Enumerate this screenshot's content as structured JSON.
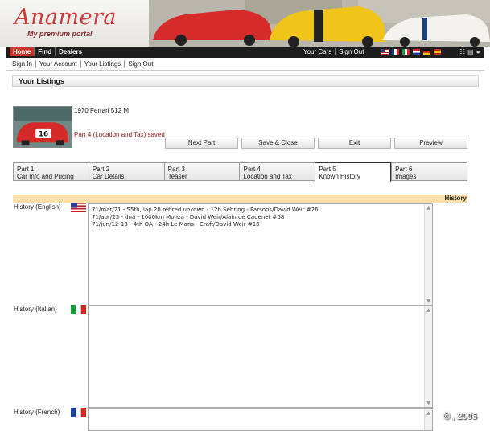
{
  "brand": {
    "logo": "Anamera",
    "tagline": "My premium portal"
  },
  "topnav": {
    "primary": [
      "Home",
      "Find",
      "Dealers"
    ],
    "active": "Home",
    "secondary": [
      "Your Cars",
      "Sign Out"
    ],
    "flags": [
      "us-flag",
      "fr-flag",
      "it-flag",
      "nl-flag",
      "de-flag",
      "es-flag"
    ]
  },
  "subnav": [
    "Sign In",
    "Your Account",
    "Your Listings",
    "Sign Out"
  ],
  "section_title": "Your Listings",
  "listing": {
    "name": "1970 Ferrari 512 M",
    "status": "Part 4 (Location and Tax) saved",
    "thumb_number": "16"
  },
  "buttons": {
    "next": "Next Part",
    "save_close": "Save & Close",
    "exit": "Exit",
    "preview": "Preview"
  },
  "tabs": [
    {
      "part": "Part 1",
      "label": "Car Info and Pricing"
    },
    {
      "part": "Part 2",
      "label": "Car Details"
    },
    {
      "part": "Part 3",
      "label": "Teaser"
    },
    {
      "part": "Part 4",
      "label": "Location and Tax"
    },
    {
      "part": "Part 5",
      "label": "Known History"
    },
    {
      "part": "Part 6",
      "label": "Images"
    }
  ],
  "history_header": "History",
  "history": {
    "english": {
      "label": "History (English)",
      "lines": [
        "71/mar/21 - 55th, lap 20 retired unkown - 12h Sebring - Parsons/David Weir #26",
        "71/apr/25 - dna - 1000km Monza - David Weir/Alain de Cadenet #68",
        "71/jun/12-13 - 4th OA - 24h Le Mans - Craft/David Weir #16"
      ]
    },
    "italian": {
      "label": "History (Italian)"
    },
    "french": {
      "label": "History (French)"
    }
  },
  "copyright": "© , 2006",
  "colors": {
    "accent": "#c8342a",
    "history_bar": "#fddfa9",
    "status_text": "#8b1a1a"
  }
}
